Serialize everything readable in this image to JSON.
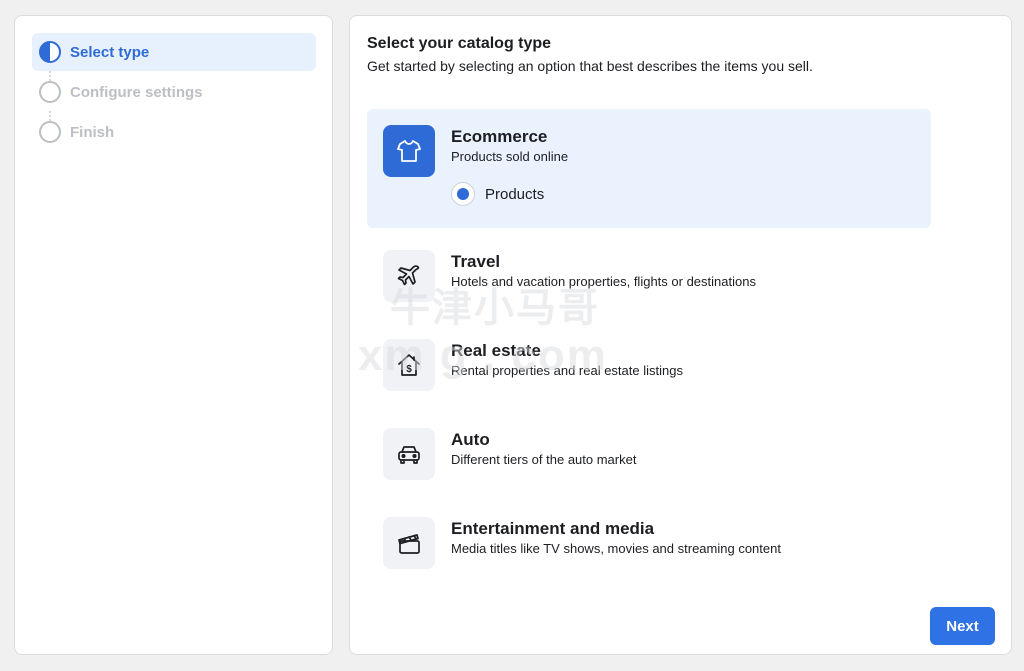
{
  "sidebar": {
    "steps": [
      {
        "label": "Select type",
        "state": "active"
      },
      {
        "label": "Configure settings",
        "state": "inactive"
      },
      {
        "label": "Finish",
        "state": "inactive"
      }
    ]
  },
  "main": {
    "title": "Select your catalog type",
    "subtitle": "Get started by selecting an option that best describes the items you sell.",
    "options": [
      {
        "title": "Ecommerce",
        "description": "Products sold online",
        "icon": "tshirt-icon",
        "selected": true,
        "sub_option": {
          "label": "Products",
          "checked": true
        }
      },
      {
        "title": "Travel",
        "description": "Hotels and vacation properties, flights or destinations",
        "icon": "airplane-icon",
        "selected": false
      },
      {
        "title": "Real estate",
        "description": "Rental properties and real estate listings",
        "icon": "house-dollar-icon",
        "selected": false
      },
      {
        "title": "Auto",
        "description": "Different tiers of the auto market",
        "icon": "car-icon",
        "selected": false
      },
      {
        "title": "Entertainment and media",
        "description": "Media titles like TV shows, movies and streaming content",
        "icon": "clapperboard-icon",
        "selected": false
      }
    ],
    "next_label": "Next"
  },
  "watermark": {
    "line1": "牛津小马哥",
    "line2": "xm g . com"
  },
  "colors": {
    "accent": "#2f6bd6",
    "button": "#2f72e6",
    "selected_bg": "#eaf2fe",
    "active_step_bg": "#e7f0fd"
  }
}
